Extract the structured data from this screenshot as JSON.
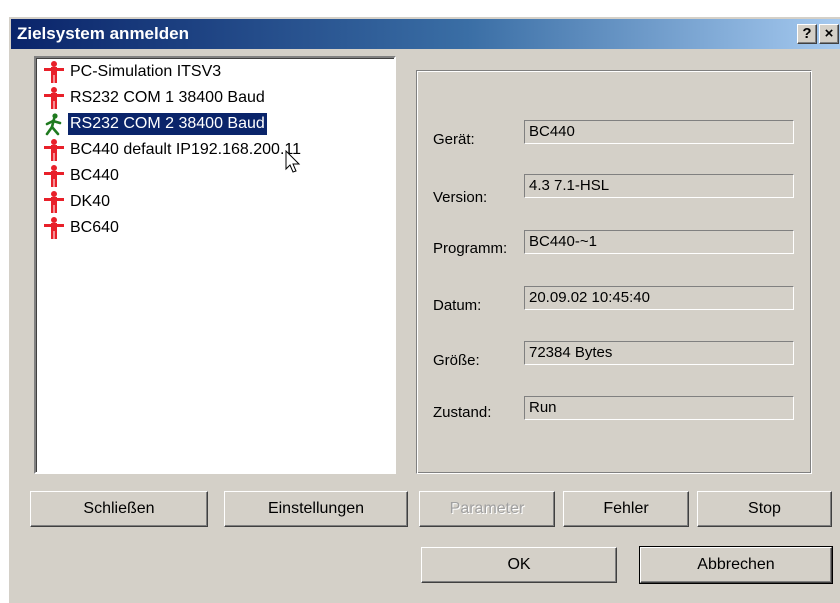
{
  "window": {
    "title": "Zielsystem anmelden",
    "help_label": "?",
    "close_label": "×"
  },
  "list": {
    "items": [
      {
        "label": "PC-Simulation ITSV3",
        "icon": "red-figure-icon",
        "selected": false
      },
      {
        "label": "RS232 COM 1 38400 Baud",
        "icon": "red-figure-icon",
        "selected": false
      },
      {
        "label": "RS232 COM 2 38400 Baud",
        "icon": "green-figure-icon",
        "selected": true
      },
      {
        "label": "BC440 default  IP192.168.200.11",
        "icon": "red-figure-icon",
        "selected": false
      },
      {
        "label": "BC440",
        "icon": "red-figure-icon",
        "selected": false
      },
      {
        "label": "DK40",
        "icon": "red-figure-icon",
        "selected": false
      },
      {
        "label": "BC640",
        "icon": "red-figure-icon",
        "selected": false
      }
    ]
  },
  "info": {
    "fields": [
      {
        "label": "Gerät:",
        "value": "BC440"
      },
      {
        "label": "Version:",
        "value": "4.3 7.1-HSL"
      },
      {
        "label": "Programm:",
        "value": "BC440-~1"
      },
      {
        "label": "Datum:",
        "value": "20.09.02 10:45:40"
      },
      {
        "label": "Größe:",
        "value": "72384 Bytes"
      },
      {
        "label": "Zustand:",
        "value": "Run"
      }
    ]
  },
  "buttons": {
    "close": "Schließen",
    "settings": "Einstellungen",
    "parameter": "Parameter",
    "error": "Fehler",
    "stop": "Stop",
    "ok": "OK",
    "cancel": "Abbrechen"
  },
  "colors": {
    "inactive_figure": "#e8202a",
    "active_figure": "#1f7a1f",
    "selection": "#0a246a"
  }
}
